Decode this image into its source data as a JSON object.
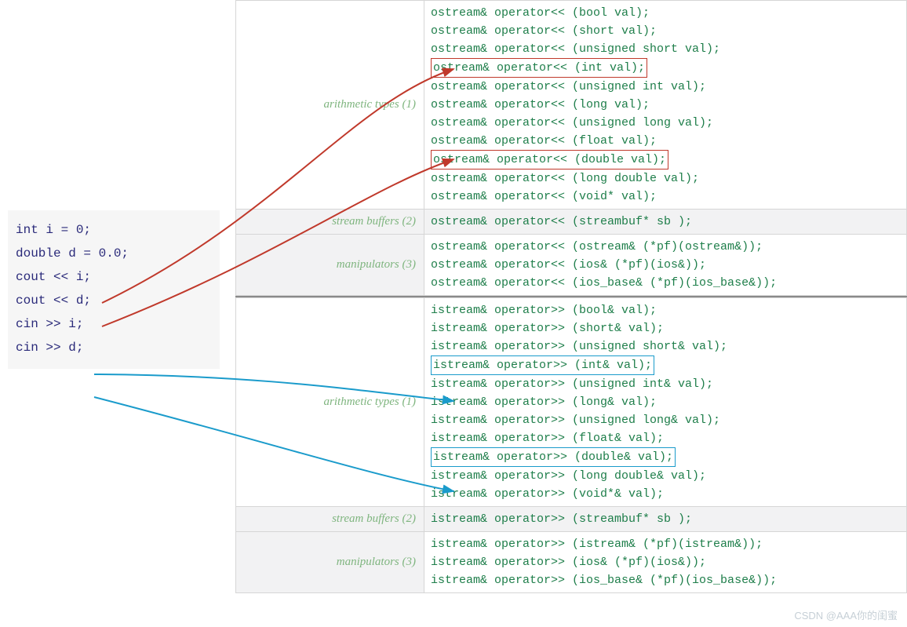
{
  "left_code": {
    "line1": "int i = 0;",
    "line2": "double d = 0.0;",
    "line3": "",
    "line4": "cout << i;",
    "line5": "cout << d;",
    "line6": "",
    "line7": "cin >> i;",
    "line8": "cin >> d;"
  },
  "labels": {
    "arith": "arithmetic types (1)",
    "buf": "stream buffers (2)",
    "manip": "manipulators (3)"
  },
  "ostream": {
    "arith": [
      "ostream& operator<< (bool val);",
      "ostream& operator<< (short val);",
      "ostream& operator<< (unsigned short val);",
      "ostream& operator<< (int val);",
      "ostream& operator<< (unsigned int val);",
      "ostream& operator<< (long val);",
      "ostream& operator<< (unsigned long val);",
      "ostream& operator<< (float val);",
      "ostream& operator<< (double val);",
      "ostream& operator<< (long double val);",
      "ostream& operator<< (void* val);"
    ],
    "buf": [
      "ostream& operator<< (streambuf* sb );"
    ],
    "manip": [
      "ostream& operator<< (ostream& (*pf)(ostream&));",
      "ostream& operator<< (ios& (*pf)(ios&));",
      "ostream& operator<< (ios_base& (*pf)(ios_base&));"
    ]
  },
  "istream": {
    "arith": [
      "istream& operator>> (bool& val);",
      "istream& operator>> (short& val);",
      "istream& operator>> (unsigned short& val);",
      "istream& operator>> (int& val);",
      "istream& operator>> (unsigned int& val);",
      "istream& operator>> (long& val);",
      "istream& operator>> (unsigned long& val);",
      "istream& operator>> (float& val);",
      "istream& operator>> (double& val);",
      "istream& operator>> (long double& val);",
      "istream& operator>> (void*& val);"
    ],
    "buf": [
      "istream& operator>> (streambuf* sb );"
    ],
    "manip": [
      "istream& operator>> (istream& (*pf)(istream&));",
      "istream& operator>> (ios& (*pf)(ios&));",
      "istream& operator>> (ios_base& (*pf)(ios_base&));"
    ]
  },
  "highlight": {
    "o_red": [
      3,
      8
    ],
    "i_blue": [
      3,
      8
    ]
  },
  "watermark": "CSDN @AAA你的闺蜜"
}
